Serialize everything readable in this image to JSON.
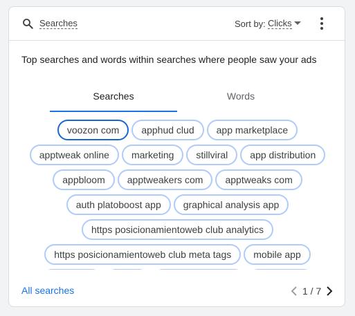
{
  "header": {
    "title": "Searches",
    "search_icon": "search-icon",
    "sort_label": "Sort by:",
    "sort_value": "Clicks",
    "more_icon": "more-vert-icon"
  },
  "description": "Top searches and words within searches where people saw your ads",
  "tabs": [
    {
      "label": "Searches",
      "active": true
    },
    {
      "label": "Words",
      "active": false
    }
  ],
  "chip_rows": [
    [
      {
        "label": "voozon com",
        "selected": true
      },
      {
        "label": "apphud clud"
      },
      {
        "label": "app marketplace"
      }
    ],
    [
      {
        "label": "apptweak online"
      },
      {
        "label": "marketing"
      },
      {
        "label": "stillviral"
      },
      {
        "label": "app distribution"
      }
    ],
    [
      {
        "label": "appbloom"
      },
      {
        "label": "apptweakers com"
      },
      {
        "label": "apptweaks com"
      }
    ],
    [
      {
        "label": "auth platoboost app"
      },
      {
        "label": "graphical analysis app"
      }
    ],
    [
      {
        "label": "https posicionamientoweb club analytics"
      }
    ],
    [
      {
        "label": "https posicionamientoweb club meta tags"
      },
      {
        "label": "mobile app"
      }
    ]
  ],
  "footer": {
    "all_searches": "All searches",
    "page_indicator": "1 / 7",
    "prev_icon": "chevron-left-icon",
    "next_icon": "chevron-right-icon"
  },
  "colors": {
    "accent": "#1a73e8",
    "chip_border": "#aecbfa",
    "chip_selected_border": "#1967d2"
  }
}
